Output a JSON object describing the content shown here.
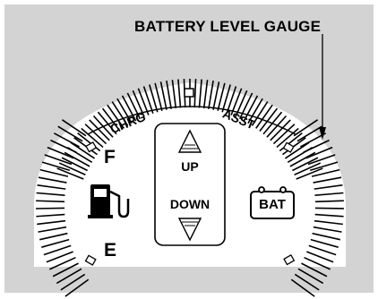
{
  "callout": {
    "title": "BATTERY LEVEL GAUGE"
  },
  "arc_labels": {
    "left": "CHRG",
    "right": "ASST"
  },
  "fuel_gauge": {
    "full": "F",
    "empty": "E",
    "icon": "fuel-pump-icon"
  },
  "indicator": {
    "up": "UP",
    "down": "DOWN",
    "up_icon": "triangle-up-icon",
    "down_icon": "triangle-down-icon"
  },
  "battery_gauge": {
    "label": "BAT",
    "icon": "battery-icon"
  }
}
